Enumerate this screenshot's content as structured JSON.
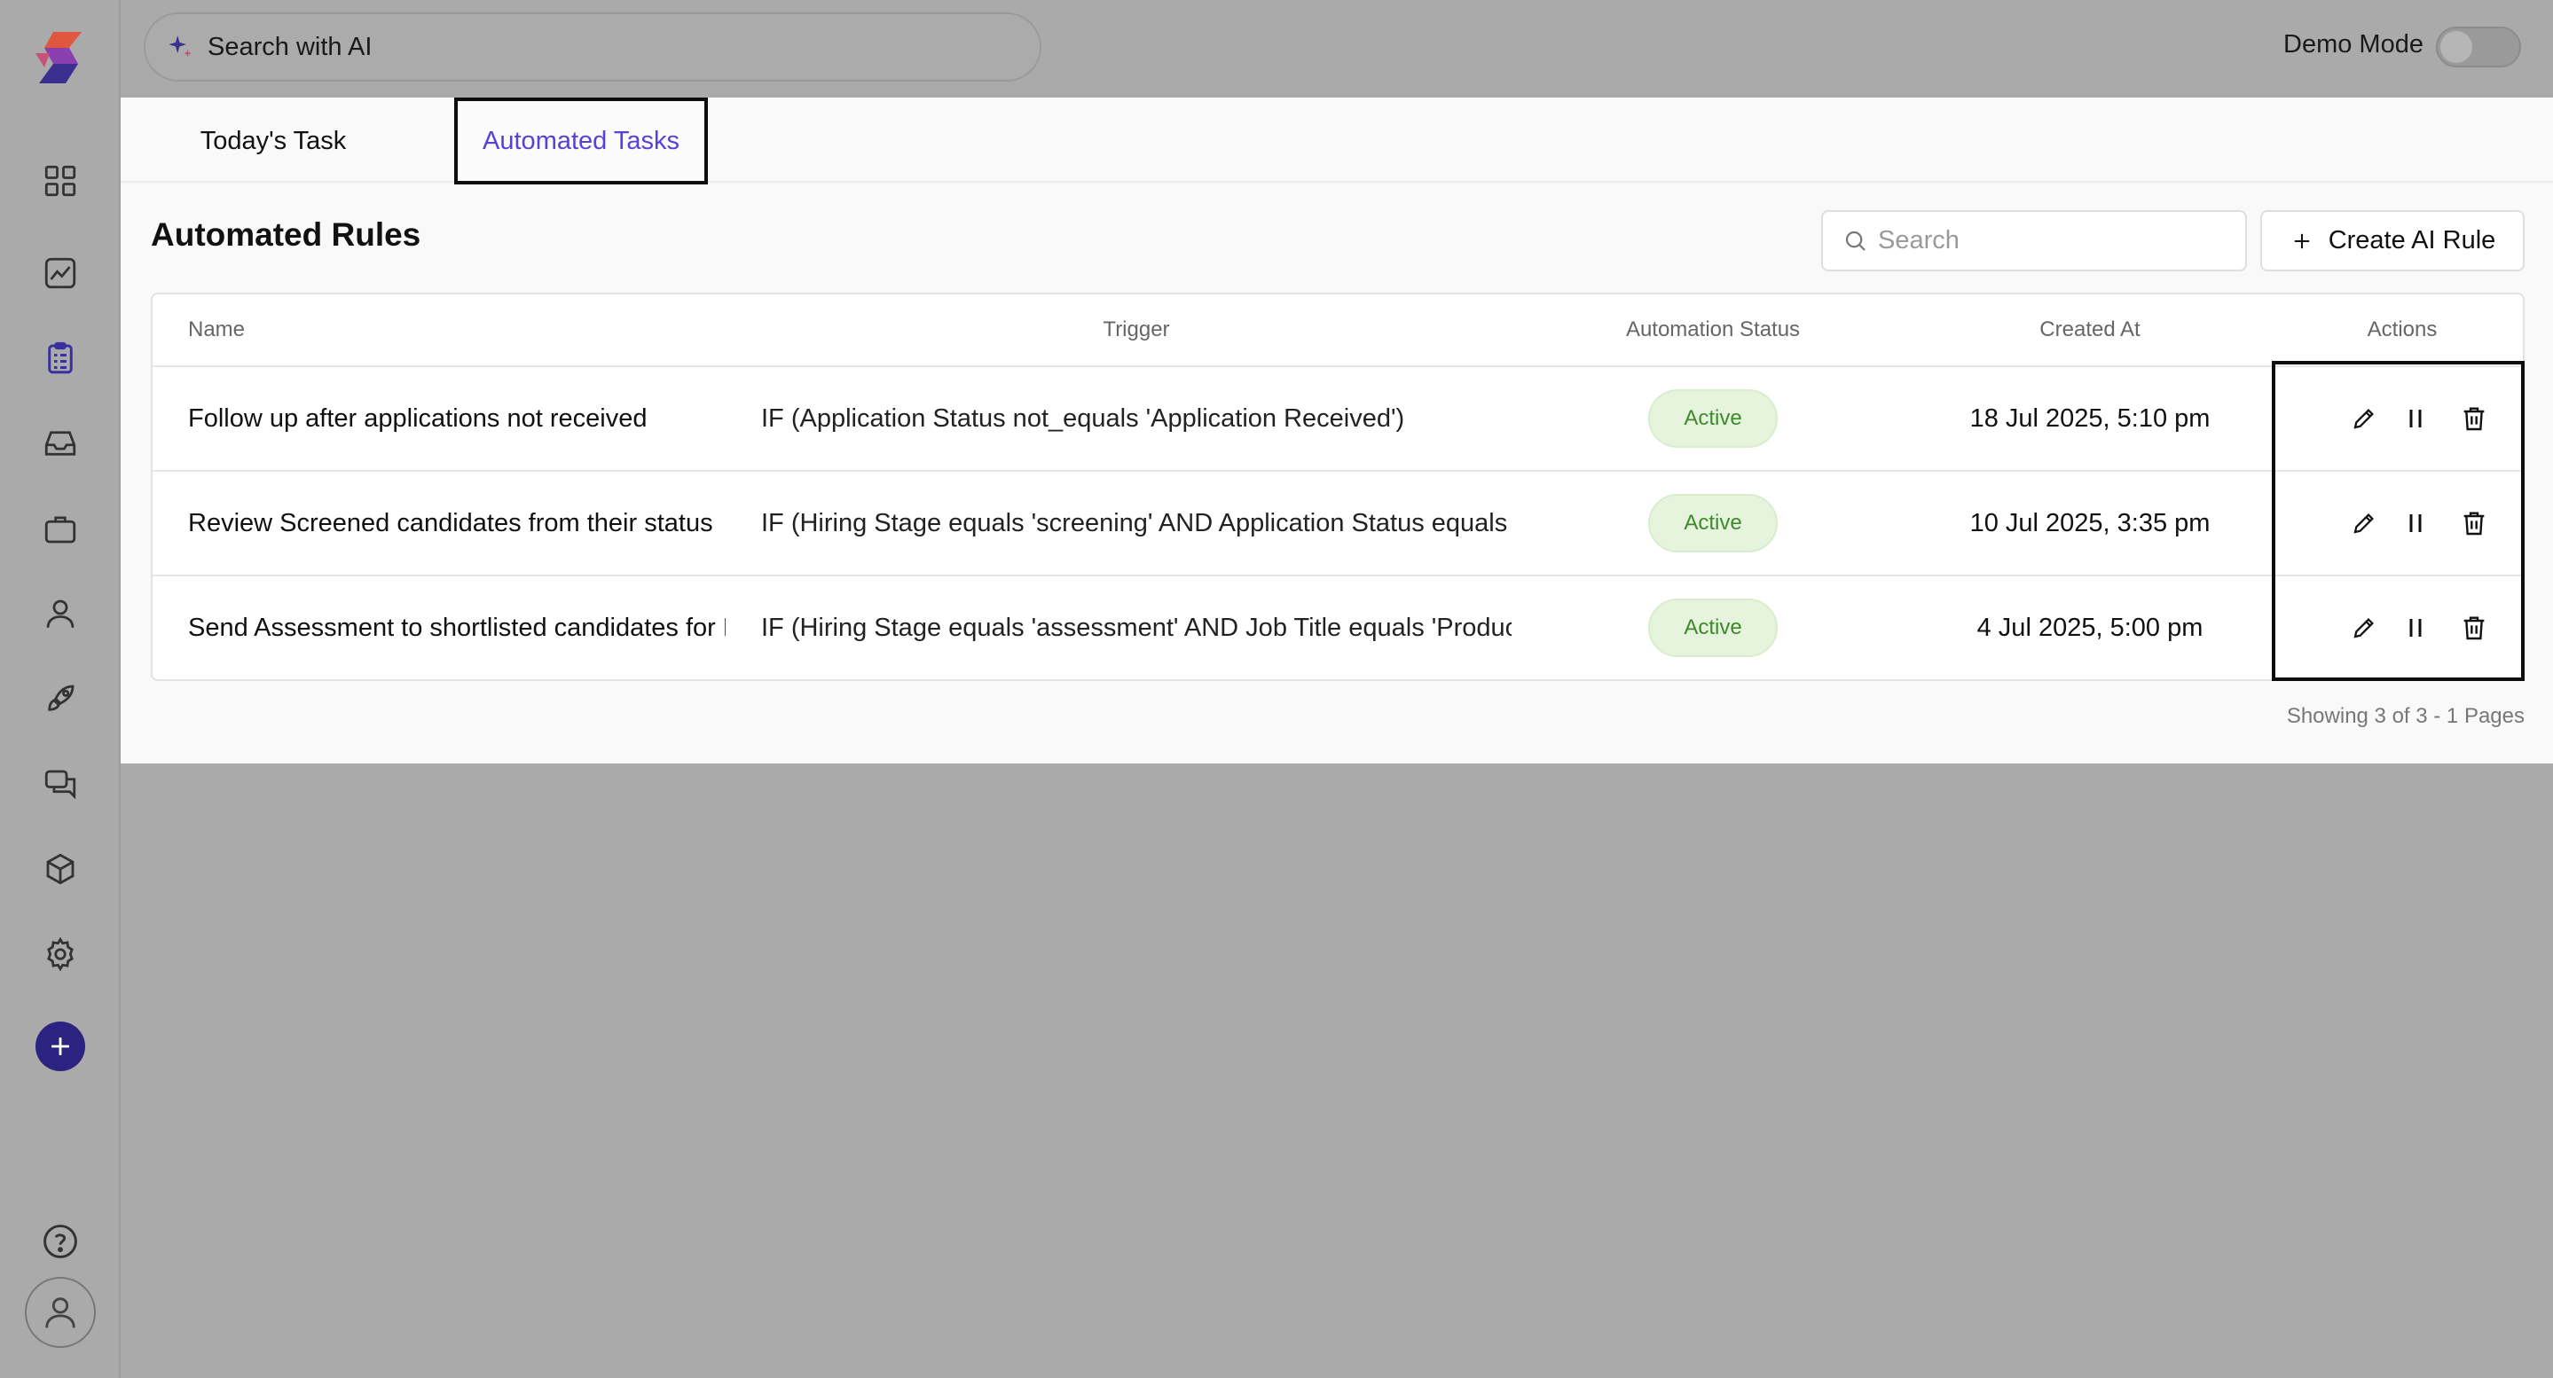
{
  "topbar": {
    "ai_search_label": "Search with AI",
    "demo_mode_label": "Demo Mode",
    "demo_mode_on": false
  },
  "sidebar": {
    "items": [
      {
        "icon": "grid-icon"
      },
      {
        "icon": "chart-icon"
      },
      {
        "icon": "clipboard-icon",
        "active": true
      },
      {
        "icon": "inbox-icon"
      },
      {
        "icon": "briefcase-icon"
      },
      {
        "icon": "user-icon"
      },
      {
        "icon": "rocket-icon"
      },
      {
        "icon": "chat-icon"
      },
      {
        "icon": "cube-icon"
      },
      {
        "icon": "gear-icon"
      }
    ],
    "accent": "#2c2380"
  },
  "tabs": [
    {
      "label": "Today's Task",
      "active": false
    },
    {
      "label": "Automated Tasks",
      "active": true
    }
  ],
  "main": {
    "title": "Automated Rules",
    "search_placeholder": "Search",
    "create_button": "Create AI Rule"
  },
  "table": {
    "columns": [
      "Name",
      "Trigger",
      "Automation Status",
      "Created At",
      "Actions"
    ],
    "rows": [
      {
        "name": "Follow up after applications not received",
        "trigger": "IF (Application Status not_equals 'Application Received')",
        "status": "Active",
        "created": "18 Jul 2025, 5:10 pm"
      },
      {
        "name": "Review Screened candidates from their status",
        "trigger": "IF (Hiring Stage equals 'screening' AND Application Status equals 'Scr",
        "status": "Active",
        "created": "10 Jul 2025, 3:35 pm"
      },
      {
        "name": "Send Assessment to shortlisted candidates for Pro",
        "trigger": "IF (Hiring Stage equals 'assessment' AND Job Title equals 'Product Er",
        "status": "Active",
        "created": "4 Jul 2025, 5:00 pm"
      }
    ],
    "footer": "Showing 3 of 3 - 1 Pages"
  },
  "colors": {
    "tab_active": "#5b3fd6",
    "status_active_bg": "#e6f4dd",
    "status_active_text": "#3d8a2a"
  }
}
